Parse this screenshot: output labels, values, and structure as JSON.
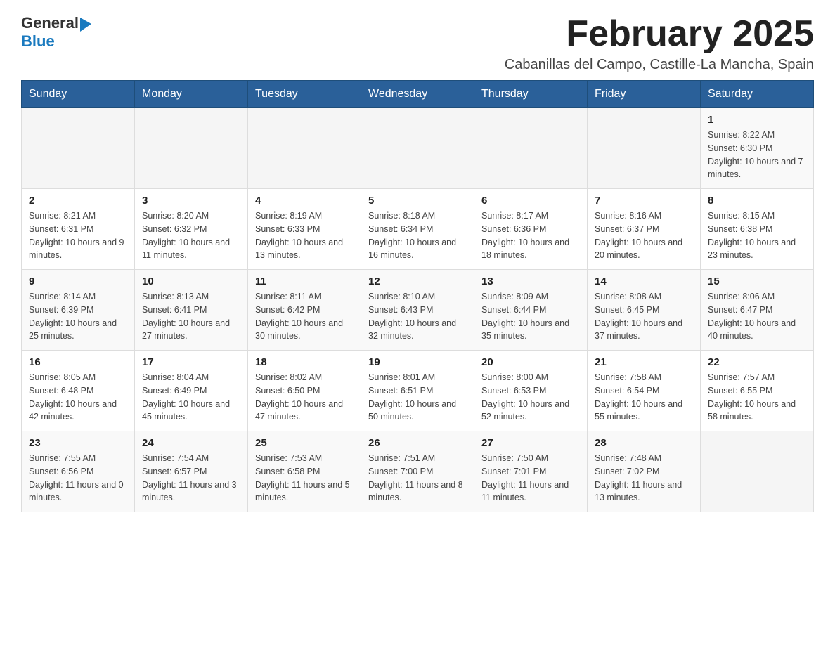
{
  "header": {
    "logo_general": "General",
    "logo_blue": "Blue",
    "month_title": "February 2025",
    "subtitle": "Cabanillas del Campo, Castille-La Mancha, Spain"
  },
  "days_of_week": [
    "Sunday",
    "Monday",
    "Tuesday",
    "Wednesday",
    "Thursday",
    "Friday",
    "Saturday"
  ],
  "weeks": [
    [
      {
        "day": "",
        "info": ""
      },
      {
        "day": "",
        "info": ""
      },
      {
        "day": "",
        "info": ""
      },
      {
        "day": "",
        "info": ""
      },
      {
        "day": "",
        "info": ""
      },
      {
        "day": "",
        "info": ""
      },
      {
        "day": "1",
        "info": "Sunrise: 8:22 AM\nSunset: 6:30 PM\nDaylight: 10 hours and 7 minutes."
      }
    ],
    [
      {
        "day": "2",
        "info": "Sunrise: 8:21 AM\nSunset: 6:31 PM\nDaylight: 10 hours and 9 minutes."
      },
      {
        "day": "3",
        "info": "Sunrise: 8:20 AM\nSunset: 6:32 PM\nDaylight: 10 hours and 11 minutes."
      },
      {
        "day": "4",
        "info": "Sunrise: 8:19 AM\nSunset: 6:33 PM\nDaylight: 10 hours and 13 minutes."
      },
      {
        "day": "5",
        "info": "Sunrise: 8:18 AM\nSunset: 6:34 PM\nDaylight: 10 hours and 16 minutes."
      },
      {
        "day": "6",
        "info": "Sunrise: 8:17 AM\nSunset: 6:36 PM\nDaylight: 10 hours and 18 minutes."
      },
      {
        "day": "7",
        "info": "Sunrise: 8:16 AM\nSunset: 6:37 PM\nDaylight: 10 hours and 20 minutes."
      },
      {
        "day": "8",
        "info": "Sunrise: 8:15 AM\nSunset: 6:38 PM\nDaylight: 10 hours and 23 minutes."
      }
    ],
    [
      {
        "day": "9",
        "info": "Sunrise: 8:14 AM\nSunset: 6:39 PM\nDaylight: 10 hours and 25 minutes."
      },
      {
        "day": "10",
        "info": "Sunrise: 8:13 AM\nSunset: 6:41 PM\nDaylight: 10 hours and 27 minutes."
      },
      {
        "day": "11",
        "info": "Sunrise: 8:11 AM\nSunset: 6:42 PM\nDaylight: 10 hours and 30 minutes."
      },
      {
        "day": "12",
        "info": "Sunrise: 8:10 AM\nSunset: 6:43 PM\nDaylight: 10 hours and 32 minutes."
      },
      {
        "day": "13",
        "info": "Sunrise: 8:09 AM\nSunset: 6:44 PM\nDaylight: 10 hours and 35 minutes."
      },
      {
        "day": "14",
        "info": "Sunrise: 8:08 AM\nSunset: 6:45 PM\nDaylight: 10 hours and 37 minutes."
      },
      {
        "day": "15",
        "info": "Sunrise: 8:06 AM\nSunset: 6:47 PM\nDaylight: 10 hours and 40 minutes."
      }
    ],
    [
      {
        "day": "16",
        "info": "Sunrise: 8:05 AM\nSunset: 6:48 PM\nDaylight: 10 hours and 42 minutes."
      },
      {
        "day": "17",
        "info": "Sunrise: 8:04 AM\nSunset: 6:49 PM\nDaylight: 10 hours and 45 minutes."
      },
      {
        "day": "18",
        "info": "Sunrise: 8:02 AM\nSunset: 6:50 PM\nDaylight: 10 hours and 47 minutes."
      },
      {
        "day": "19",
        "info": "Sunrise: 8:01 AM\nSunset: 6:51 PM\nDaylight: 10 hours and 50 minutes."
      },
      {
        "day": "20",
        "info": "Sunrise: 8:00 AM\nSunset: 6:53 PM\nDaylight: 10 hours and 52 minutes."
      },
      {
        "day": "21",
        "info": "Sunrise: 7:58 AM\nSunset: 6:54 PM\nDaylight: 10 hours and 55 minutes."
      },
      {
        "day": "22",
        "info": "Sunrise: 7:57 AM\nSunset: 6:55 PM\nDaylight: 10 hours and 58 minutes."
      }
    ],
    [
      {
        "day": "23",
        "info": "Sunrise: 7:55 AM\nSunset: 6:56 PM\nDaylight: 11 hours and 0 minutes."
      },
      {
        "day": "24",
        "info": "Sunrise: 7:54 AM\nSunset: 6:57 PM\nDaylight: 11 hours and 3 minutes."
      },
      {
        "day": "25",
        "info": "Sunrise: 7:53 AM\nSunset: 6:58 PM\nDaylight: 11 hours and 5 minutes."
      },
      {
        "day": "26",
        "info": "Sunrise: 7:51 AM\nSunset: 7:00 PM\nDaylight: 11 hours and 8 minutes."
      },
      {
        "day": "27",
        "info": "Sunrise: 7:50 AM\nSunset: 7:01 PM\nDaylight: 11 hours and 11 minutes."
      },
      {
        "day": "28",
        "info": "Sunrise: 7:48 AM\nSunset: 7:02 PM\nDaylight: 11 hours and 13 minutes."
      },
      {
        "day": "",
        "info": ""
      }
    ]
  ]
}
